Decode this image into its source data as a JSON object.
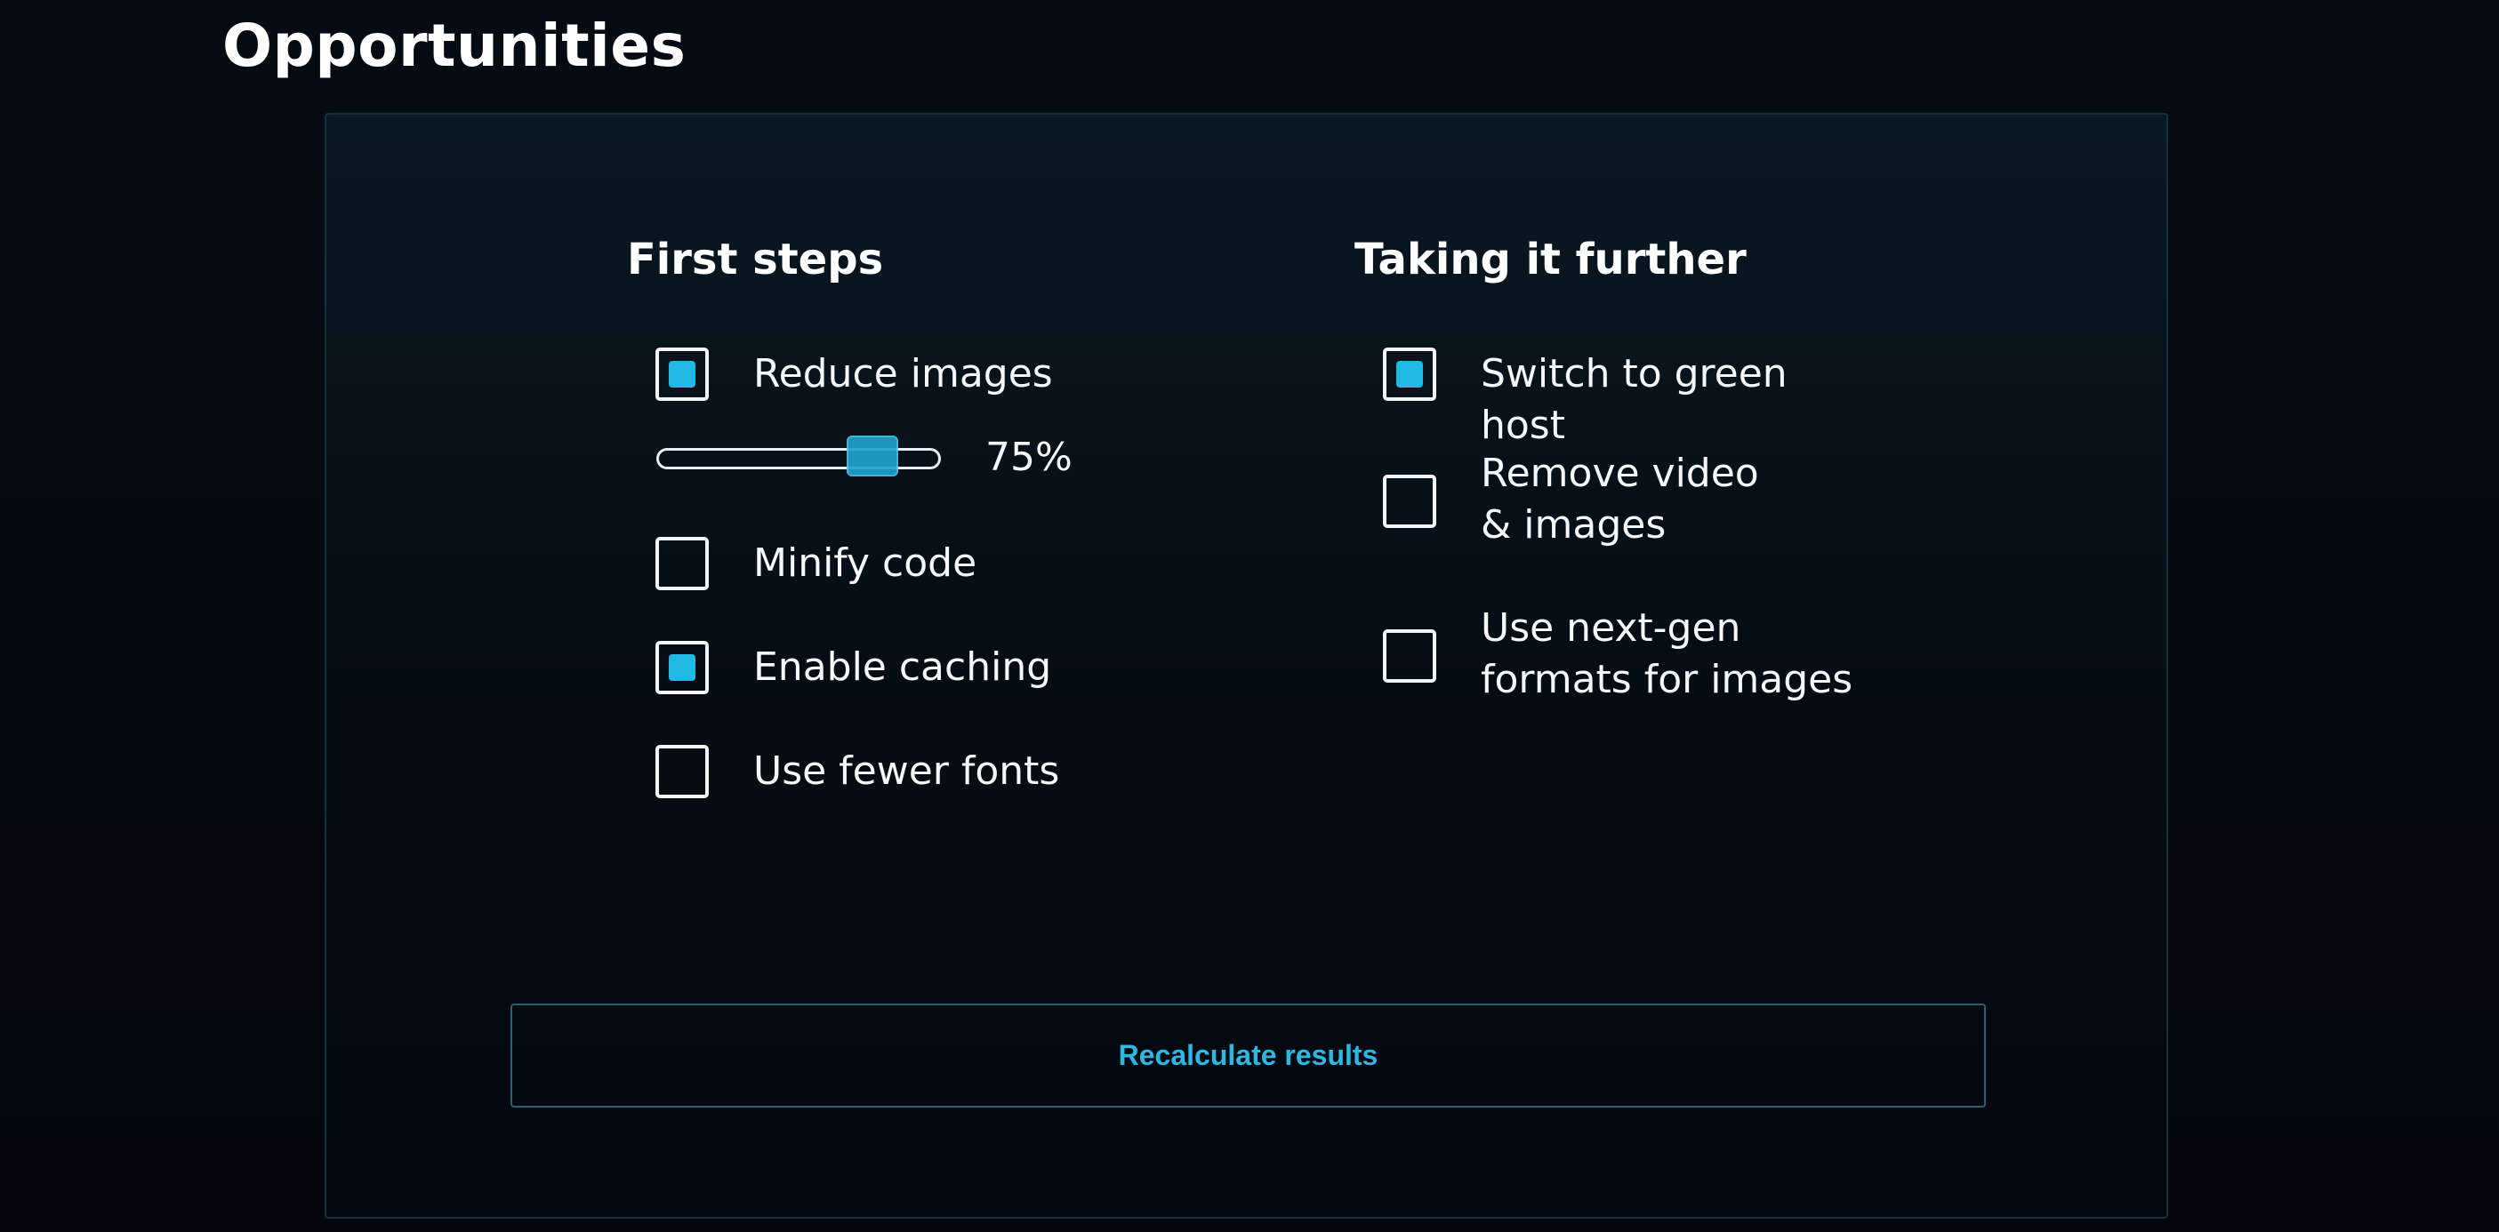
{
  "page": {
    "title": "Opportunities"
  },
  "first_steps": {
    "heading": "First steps",
    "options": [
      {
        "label": "Reduce images",
        "checked": true
      },
      {
        "label": "Minify code",
        "checked": false
      },
      {
        "label": "Enable caching",
        "checked": true
      },
      {
        "label": "Use fewer fonts",
        "checked": false
      }
    ],
    "image_reduction_slider": {
      "value_percent": 75,
      "value_label": "75%"
    }
  },
  "taking_further": {
    "heading": "Taking it further",
    "options": [
      {
        "label": "Switch to green host",
        "checked": true
      },
      {
        "label": "Remove video & images",
        "checked": false
      },
      {
        "label": "Use next-gen formats for images",
        "checked": false
      }
    ]
  },
  "actions": {
    "recalculate_label": "Recalculate results"
  },
  "colors": {
    "accent": "#21b8e6",
    "button_text": "#2cb8e3",
    "panel_border": "#17313a",
    "background": "#03070d"
  }
}
